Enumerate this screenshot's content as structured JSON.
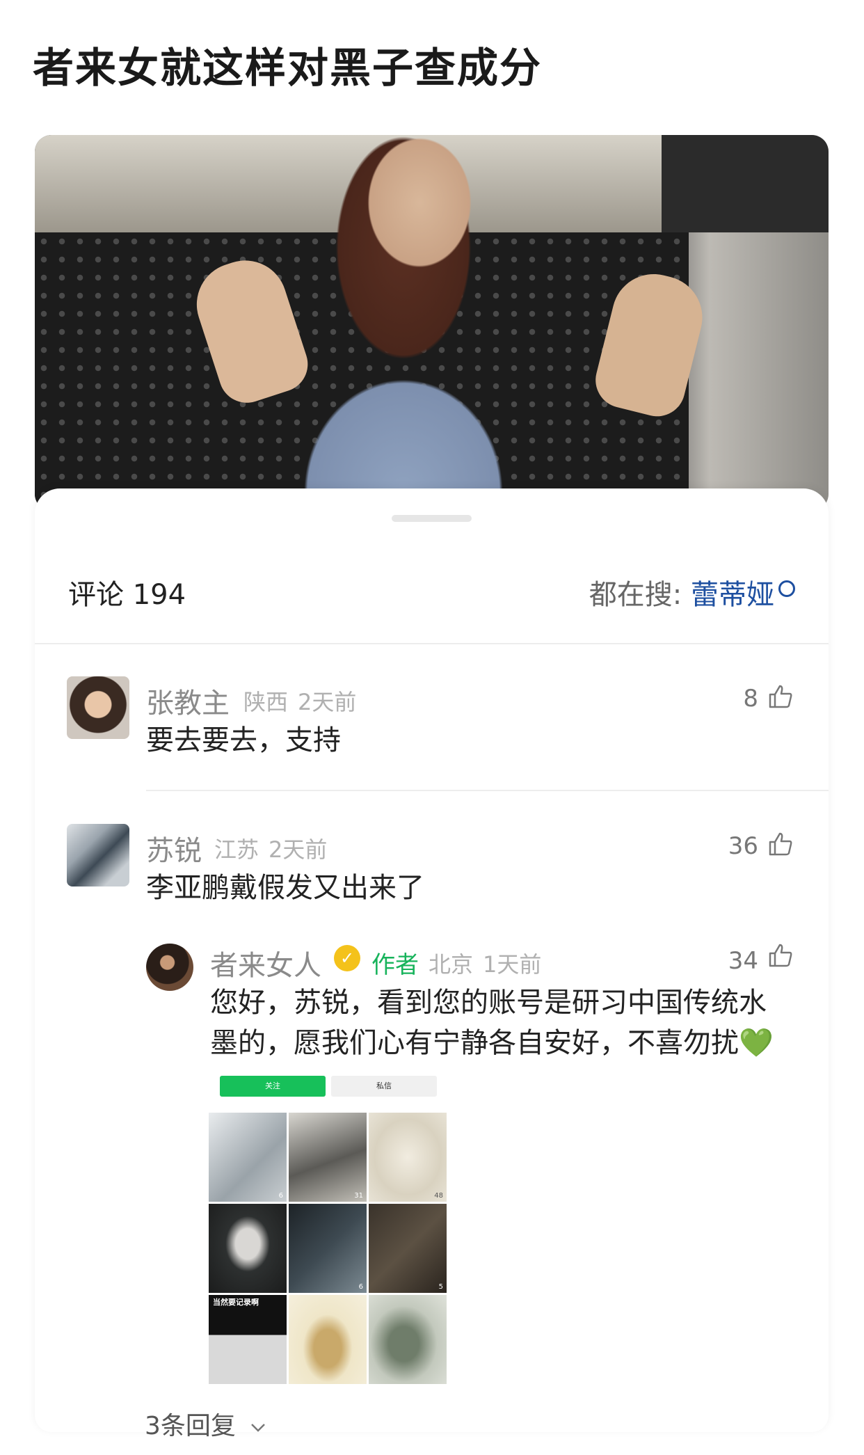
{
  "post": {
    "title": "者来女就这样对黑子查成分"
  },
  "comments_panel": {
    "count_label": "评论 194",
    "search_prefix": "都在搜:",
    "search_keyword": "蕾蒂娅"
  },
  "comments": [
    {
      "user": "张教主",
      "location": "陕西",
      "time": "2天前",
      "likes": "8",
      "text": "要去要去，支持"
    },
    {
      "user": "苏锐",
      "location": "江苏",
      "time": "2天前",
      "likes": "36",
      "text": "李亚鹏戴假发又出来了"
    }
  ],
  "reply": {
    "user": "者来女人",
    "author_tag": "作者",
    "location": "北京",
    "time": "1天前",
    "likes": "34",
    "text_line1": "您好，苏锐，看到您的账号是研习中国传统水",
    "text_line2": "墨的，愿我们心有宁静各自安好，不喜勿扰",
    "emoji": "💚",
    "screenshot": {
      "follow_label": "关注",
      "message_label": "私信",
      "tiles": [
        {
          "likes": "6",
          "caption": ""
        },
        {
          "likes": "31",
          "caption": ""
        },
        {
          "likes": "48",
          "caption": ""
        },
        {
          "likes": "",
          "caption": ""
        },
        {
          "likes": "6",
          "caption": ""
        },
        {
          "likes": "5",
          "caption": ""
        },
        {
          "likes": "",
          "caption": "当然要记录啊"
        },
        {
          "likes": "",
          "caption": ""
        },
        {
          "likes": "",
          "caption": ""
        }
      ]
    }
  },
  "replies_toggle": "3条回复",
  "colors": {
    "author_green": "#17b35b",
    "verified_gold": "#f4c21b",
    "keyword_blue": "#1d4fa0"
  }
}
